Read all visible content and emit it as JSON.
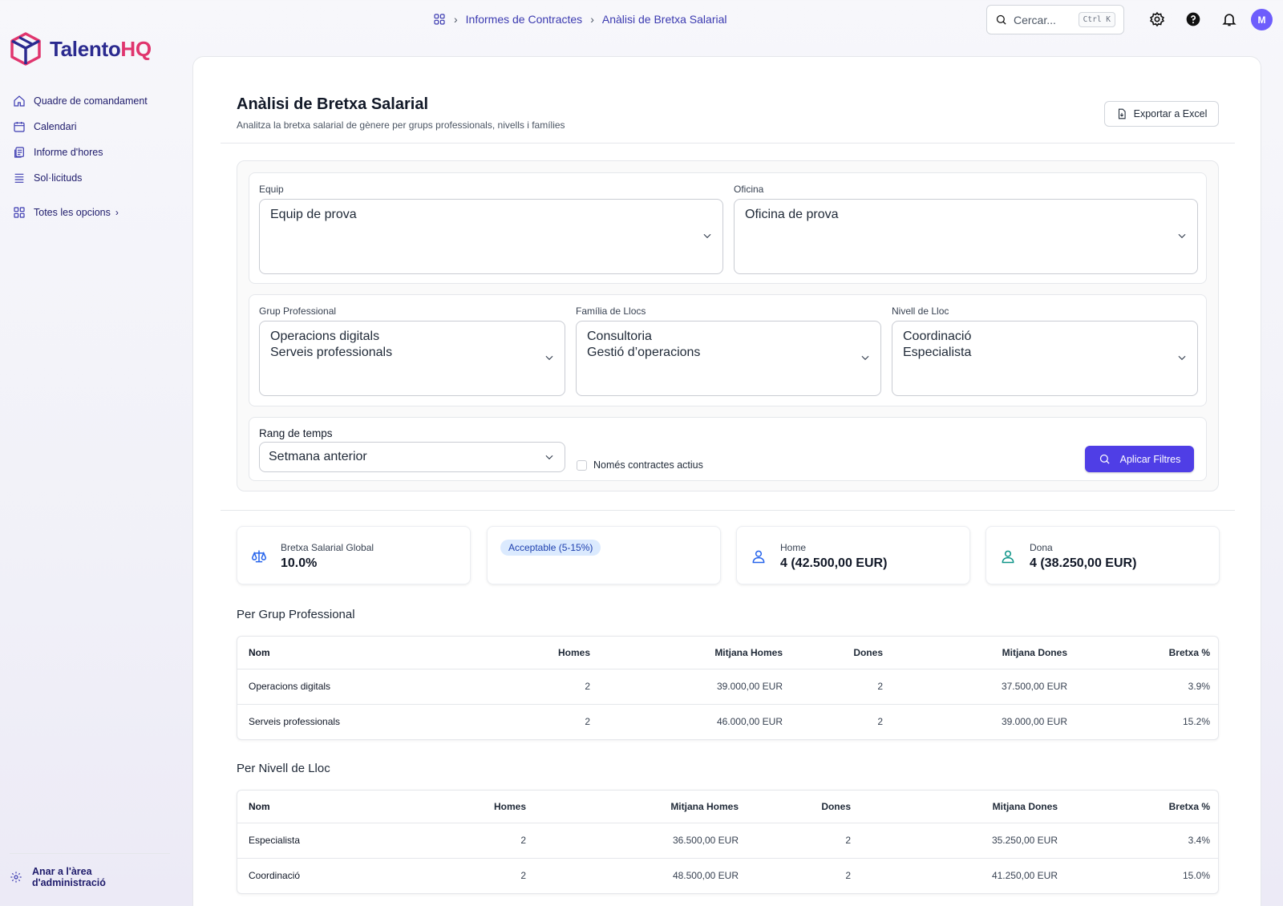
{
  "app": {
    "logo_main": "Talento",
    "logo_accent": "HQ"
  },
  "sidebar": {
    "items": [
      {
        "label": "Quadre de comandament",
        "icon": "home-icon"
      },
      {
        "label": "Calendari",
        "icon": "calendar-icon"
      },
      {
        "label": "Informe d'hores",
        "icon": "report-icon"
      },
      {
        "label": "Sol·licituds",
        "icon": "list-icon"
      }
    ],
    "all_options": "Totes les opcions",
    "admin_line1": "Anar a l'àrea",
    "admin_line2": "d'administració"
  },
  "topbar": {
    "breadcrumb": [
      "Informes de Contractes",
      "Anàlisi de Bretxa Salarial"
    ],
    "search_placeholder": "Cercar...",
    "search_shortcut": "Ctrl K",
    "avatar_initial": "M"
  },
  "page": {
    "title": "Anàlisi de Bretxa Salarial",
    "subtitle": "Analitza la bretxa salarial de gènere per grups professionals, nivells i famílies",
    "export_label": "Exportar a Excel"
  },
  "filters": {
    "team_label": "Equip",
    "team_value": "Equip de prova",
    "office_label": "Oficina",
    "office_value": "Oficina de prova",
    "group_label": "Grup Professional",
    "group_values": [
      "Operacions digitals",
      "Serveis professionals"
    ],
    "family_label": "Família de Llocs",
    "family_values": [
      "Consultoria",
      "Gestió d’operacions"
    ],
    "level_label": "Nivell de Lloc",
    "level_values": [
      "Coordinació",
      "Especialista"
    ],
    "time_label": "Rang de temps",
    "time_value": "Setmana anterior",
    "active_only_label": "Només contractes actius",
    "active_only_checked": false,
    "apply_label": "Aplicar Filtres"
  },
  "stats": {
    "gap_label": "Bretxa Salarial Global",
    "gap_value": "10.0%",
    "status_badge": "Acceptable (5-15%)",
    "men_label": "Home",
    "men_value": "4 (42.500,00 EUR)",
    "women_label": "Dona",
    "women_value": "4 (38.250,00 EUR)"
  },
  "by_group": {
    "title": "Per Grup Professional",
    "headers": [
      "Nom",
      "Homes",
      "Mitjana Homes",
      "Dones",
      "Mitjana Dones",
      "Bretxa %"
    ],
    "rows": [
      [
        "Operacions digitals",
        "2",
        "39.000,00 EUR",
        "2",
        "37.500,00 EUR",
        "3.9%"
      ],
      [
        "Serveis professionals",
        "2",
        "46.000,00 EUR",
        "2",
        "39.000,00 EUR",
        "15.2%"
      ]
    ]
  },
  "by_level": {
    "title": "Per Nivell de Lloc",
    "headers": [
      "Nom",
      "Homes",
      "Mitjana Homes",
      "Dones",
      "Mitjana Dones",
      "Bretxa %"
    ],
    "rows": [
      [
        "Especialista",
        "2",
        "36.500,00 EUR",
        "2",
        "35.250,00 EUR",
        "3.4%"
      ],
      [
        "Coordinació",
        "2",
        "48.500,00 EUR",
        "2",
        "41.250,00 EUR",
        "15.0%"
      ]
    ]
  },
  "colors": {
    "brand": "#2b2a8f",
    "accent": "#e0356e",
    "primary_button": "#4f3ee6",
    "badge_bg": "#dbeafe"
  }
}
